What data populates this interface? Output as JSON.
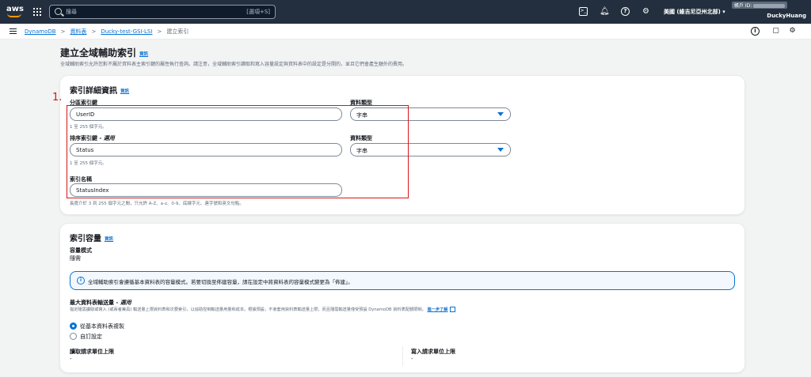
{
  "topnav": {
    "logo_text": "aws",
    "search_placeholder": "搜尋",
    "search_shortcut": "[選項+S]",
    "region": "美國 (維吉尼亞州北部) ▾",
    "account_id_label": "帳戶 ID: ",
    "user": "DuckyHuang"
  },
  "breadcrumb": {
    "items": [
      "DynamoDB",
      "資料表",
      "Ducky-test-GSI-LSI"
    ],
    "current": "建立索引",
    "separator": ">"
  },
  "header": {
    "title": "建立全域輔助索引",
    "info": "資訊",
    "description": "全域輔助索引允許您對不屬於資料表主索引鍵的屬性執行查詢。請注意，全域輔助索引讀取和寫入容量設定與資料表中的設定是分開的，並且它們會產生額外的費用。"
  },
  "details": {
    "title": "索引詳細資訊",
    "info": "資訊",
    "annotation_number": "1.",
    "partition_key": {
      "label": "分區索引鍵",
      "value": "UserID",
      "hint": "1 至 255 個字元。",
      "type_label": "資料類型",
      "type_value": "字串"
    },
    "sort_key": {
      "label_main": "排序索引鍵 - ",
      "label_optional": "選用",
      "value": "Status",
      "hint": "1 至 255 個字元。",
      "type_label": "資料類型",
      "type_value": "字串"
    },
    "index_name": {
      "label": "索引名稱",
      "value": "StatusIndex",
      "hint": "長度介於 3 到 255 個字元之間，只允許 A-Z、a-z、0-9、底線字元、連字號和英文句點。"
    }
  },
  "capacity": {
    "title": "索引容量",
    "info": "資訊",
    "mode_label": "容量模式",
    "mode_value": "隨需",
    "alert": "全域輔助索引會遵循基本資料表的容量模式。若要切換至佈建容量，請在設定中將資料表的容量模式變更為「佈建」。",
    "max_label_main": "最大資料表輸送量 - ",
    "max_label_optional": "選用",
    "max_desc": "指定隨需讀取或寫入 (或兩者兼具) 輸送量上限資料表和次要索引，以協助控制輸送量用量和成本。根據預設，不會套用資料表輸送量上限，而且隨需輸送量僅受預設 DynamoDB 資料表配額限制。",
    "learn_more": "進一步了解",
    "options": [
      "從基本資料表複製",
      "自訂設定"
    ],
    "read_label": "讀取請求單位上限",
    "read_value": "-",
    "write_label": "寫入請求單位上限",
    "write_value": "-"
  },
  "colors": {
    "nav_bg": "#232f3e",
    "link": "#0972d3",
    "annotation": "#d91515"
  }
}
